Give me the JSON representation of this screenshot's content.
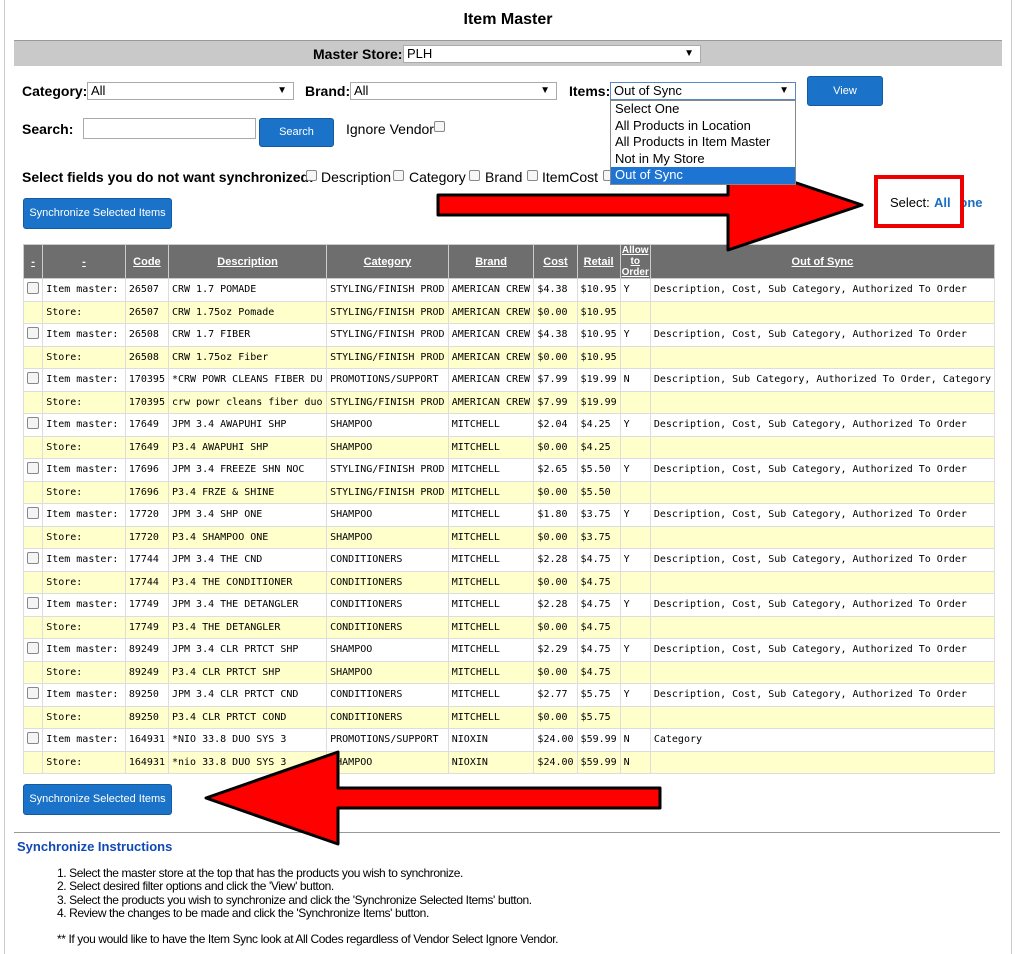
{
  "page": {
    "title": "Item Master"
  },
  "master_store": {
    "label": "Master Store:",
    "value": "PLH"
  },
  "filters": {
    "category_label": "Category:",
    "category_value": "All",
    "brand_label": "Brand:",
    "brand_value": "All",
    "items_label": "Items:",
    "items_value": "Out of Sync",
    "items_options": [
      "Select One",
      "All Products in Location",
      "All Products in Item Master",
      "Not in My Store",
      "Out of Sync"
    ],
    "view_button": "View",
    "search_label": "Search:",
    "search_value": "",
    "search_button": "Search",
    "ignore_vendor_label": "Ignore Vendor"
  },
  "sync_fields": {
    "label": "Select fields you do not want synchronized:",
    "options": [
      "Description",
      "Category",
      "Brand",
      "ItemCost"
    ]
  },
  "select_links": {
    "label": "Select:",
    "all": "All",
    "none": "None"
  },
  "sync_button": "Synchronize Selected Items",
  "table": {
    "headers": [
      "-",
      "-",
      "Code",
      "Description",
      "Category",
      "Brand",
      "Cost",
      "Retail",
      "Allow to Order",
      "Out of Sync"
    ],
    "rows": [
      {
        "type": "Item master:",
        "code": "26507",
        "desc": "CRW 1.7 POMADE",
        "cat": "STYLING/FINISH PROD",
        "brand": "AMERICAN CREW",
        "cost": "$4.38",
        "retail": "$10.95",
        "allow": "Y",
        "sync": "Description, Cost, Sub Category, Authorized To Order"
      },
      {
        "type": "Store:",
        "code": "26507",
        "desc": "CRW 1.75oz Pomade",
        "cat": "STYLING/FINISH PROD",
        "brand": "AMERICAN CREW",
        "cost": "$0.00",
        "retail": "$10.95",
        "allow": "",
        "sync": ""
      },
      {
        "type": "Item master:",
        "code": "26508",
        "desc": "CRW 1.7 FIBER",
        "cat": "STYLING/FINISH PROD",
        "brand": "AMERICAN CREW",
        "cost": "$4.38",
        "retail": "$10.95",
        "allow": "Y",
        "sync": "Description, Cost, Sub Category, Authorized To Order"
      },
      {
        "type": "Store:",
        "code": "26508",
        "desc": "CRW 1.75oz Fiber",
        "cat": "STYLING/FINISH PROD",
        "brand": "AMERICAN CREW",
        "cost": "$0.00",
        "retail": "$10.95",
        "allow": "",
        "sync": ""
      },
      {
        "type": "Item master:",
        "code": "170395",
        "desc": "*CRW POWR CLEANS FIBER DU",
        "cat": "PROMOTIONS/SUPPORT",
        "brand": "AMERICAN CREW",
        "cost": "$7.99",
        "retail": "$19.99",
        "allow": "N",
        "sync": "Description, Sub Category, Authorized To Order, Category"
      },
      {
        "type": "Store:",
        "code": "170395",
        "desc": "crw powr cleans fiber duo",
        "cat": "STYLING/FINISH PROD",
        "brand": "AMERICAN CREW",
        "cost": "$7.99",
        "retail": "$19.99",
        "allow": "",
        "sync": ""
      },
      {
        "type": "Item master:",
        "code": "17649",
        "desc": "JPM 3.4 AWAPUHI SHP",
        "cat": "SHAMPOO",
        "brand": "MITCHELL",
        "cost": "$2.04",
        "retail": "$4.25",
        "allow": "Y",
        "sync": "Description, Cost, Sub Category, Authorized To Order"
      },
      {
        "type": "Store:",
        "code": "17649",
        "desc": "P3.4 AWAPUHI SHP",
        "cat": "SHAMPOO",
        "brand": "MITCHELL",
        "cost": "$0.00",
        "retail": "$4.25",
        "allow": "",
        "sync": ""
      },
      {
        "type": "Item master:",
        "code": "17696",
        "desc": "JPM 3.4 FREEZE SHN NOC",
        "cat": "STYLING/FINISH PROD",
        "brand": "MITCHELL",
        "cost": "$2.65",
        "retail": "$5.50",
        "allow": "Y",
        "sync": "Description, Cost, Sub Category, Authorized To Order"
      },
      {
        "type": "Store:",
        "code": "17696",
        "desc": "P3.4 FRZE & SHINE",
        "cat": "STYLING/FINISH PROD",
        "brand": "MITCHELL",
        "cost": "$0.00",
        "retail": "$5.50",
        "allow": "",
        "sync": ""
      },
      {
        "type": "Item master:",
        "code": "17720",
        "desc": "JPM 3.4 SHP ONE",
        "cat": "SHAMPOO",
        "brand": "MITCHELL",
        "cost": "$1.80",
        "retail": "$3.75",
        "allow": "Y",
        "sync": "Description, Cost, Sub Category, Authorized To Order"
      },
      {
        "type": "Store:",
        "code": "17720",
        "desc": "P3.4 SHAMPOO ONE",
        "cat": "SHAMPOO",
        "brand": "MITCHELL",
        "cost": "$0.00",
        "retail": "$3.75",
        "allow": "",
        "sync": ""
      },
      {
        "type": "Item master:",
        "code": "17744",
        "desc": "JPM 3.4 THE CND",
        "cat": "CONDITIONERS",
        "brand": "MITCHELL",
        "cost": "$2.28",
        "retail": "$4.75",
        "allow": "Y",
        "sync": "Description, Cost, Sub Category, Authorized To Order"
      },
      {
        "type": "Store:",
        "code": "17744",
        "desc": "P3.4 THE CONDITIONER",
        "cat": "CONDITIONERS",
        "brand": "MITCHELL",
        "cost": "$0.00",
        "retail": "$4.75",
        "allow": "",
        "sync": ""
      },
      {
        "type": "Item master:",
        "code": "17749",
        "desc": "JPM 3.4 THE DETANGLER",
        "cat": "CONDITIONERS",
        "brand": "MITCHELL",
        "cost": "$2.28",
        "retail": "$4.75",
        "allow": "Y",
        "sync": "Description, Cost, Sub Category, Authorized To Order"
      },
      {
        "type": "Store:",
        "code": "17749",
        "desc": "P3.4 THE DETANGLER",
        "cat": "CONDITIONERS",
        "brand": "MITCHELL",
        "cost": "$0.00",
        "retail": "$4.75",
        "allow": "",
        "sync": ""
      },
      {
        "type": "Item master:",
        "code": "89249",
        "desc": "JPM 3.4 CLR PRTCT SHP",
        "cat": "SHAMPOO",
        "brand": "MITCHELL",
        "cost": "$2.29",
        "retail": "$4.75",
        "allow": "Y",
        "sync": "Description, Cost, Sub Category, Authorized To Order"
      },
      {
        "type": "Store:",
        "code": "89249",
        "desc": "P3.4 CLR PRTCT SHP",
        "cat": "SHAMPOO",
        "brand": "MITCHELL",
        "cost": "$0.00",
        "retail": "$4.75",
        "allow": "",
        "sync": ""
      },
      {
        "type": "Item master:",
        "code": "89250",
        "desc": "JPM 3.4 CLR PRTCT CND",
        "cat": "CONDITIONERS",
        "brand": "MITCHELL",
        "cost": "$2.77",
        "retail": "$5.75",
        "allow": "Y",
        "sync": "Description, Cost, Sub Category, Authorized To Order"
      },
      {
        "type": "Store:",
        "code": "89250",
        "desc": "P3.4 CLR PRTCT COND",
        "cat": "CONDITIONERS",
        "brand": "MITCHELL",
        "cost": "$0.00",
        "retail": "$5.75",
        "allow": "",
        "sync": ""
      },
      {
        "type": "Item master:",
        "code": "164931",
        "desc": "*NIO 33.8 DUO SYS 3",
        "cat": "PROMOTIONS/SUPPORT",
        "brand": "NIOXIN",
        "cost": "$24.00",
        "retail": "$59.99",
        "allow": "N",
        "sync": "Category"
      },
      {
        "type": "Store:",
        "code": "164931",
        "desc": "*nio 33.8 DUO SYS 3",
        "cat": "SHAMPOO",
        "brand": "NIOXIN",
        "cost": "$24.00",
        "retail": "$59.99",
        "allow": "N",
        "sync": ""
      }
    ]
  },
  "instructions": {
    "title": "Synchronize Instructions",
    "steps": [
      "1. Select the master store at the top that has the products you wish to synchronize.",
      "2. Select desired filter options and click the 'View' button.",
      "3. Select the products you wish to synchronize and click the 'Synchronize Selected Items' button.",
      "4. Review the changes to be made and click the 'Synchronize Items' button."
    ],
    "note": "** If you would like to have the Item Sync look at All Codes regardless of Vendor Select Ignore Vendor."
  },
  "colors": {
    "button": "#1a73c8",
    "header": "#6e6e6e",
    "store_row": "#ffffcc",
    "annotation": "#ff0000"
  }
}
